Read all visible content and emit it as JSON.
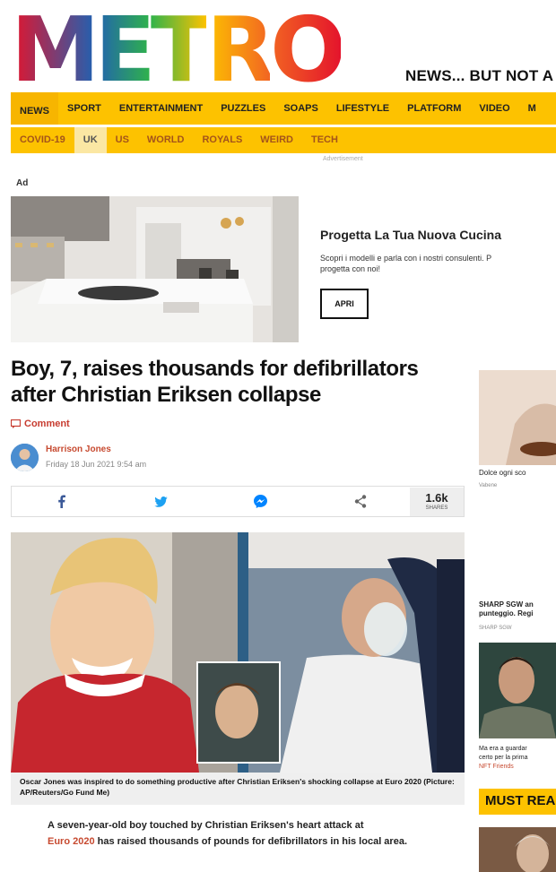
{
  "brand": {
    "logo_letters": [
      "M",
      "E",
      "T",
      "R",
      "O"
    ],
    "logo_colors": [
      "#e4142c",
      "#f26522",
      "#fdc200",
      "#2fb34a",
      "#2161b1",
      "#6b2fa0"
    ],
    "tagline": "NEWS... BUT NOT A"
  },
  "nav_primary": [
    {
      "label": "NEWS",
      "active": true
    },
    {
      "label": "SPORT"
    },
    {
      "label": "ENTERTAINMENT"
    },
    {
      "label": "PUZZLES"
    },
    {
      "label": "SOAPS"
    },
    {
      "label": "LIFESTYLE"
    },
    {
      "label": "PLATFORM"
    },
    {
      "label": "VIDEO"
    },
    {
      "label": "M"
    }
  ],
  "nav_secondary": [
    {
      "label": "COVID-19"
    },
    {
      "label": "UK",
      "active": true
    },
    {
      "label": "US"
    },
    {
      "label": "WORLD"
    },
    {
      "label": "ROYALS"
    },
    {
      "label": "WEIRD"
    },
    {
      "label": "TECH"
    }
  ],
  "ad": {
    "top_label": "Advertisement",
    "tag": "Ad",
    "title": "Progetta La Tua Nuova Cucina",
    "desc_line1": "Scopri i modelli e parla con i nostri consulenti. P",
    "desc_line2": "progetta con noi!",
    "button": "APRI"
  },
  "article": {
    "headline": "Boy, 7, raises thousands for defibrillators after Christian Eriksen collapse",
    "comment_label": "Comment",
    "author": "Harrison Jones",
    "date": "Friday 18 Jun 2021 9:54 am",
    "share_count": "1.6k",
    "share_label": "SHARES",
    "caption": "Oscar Jones was inspired to do something productive after Christian Eriksen's shocking collapse at Euro 2020 (Picture: AP/Reuters/Go Fund Me)",
    "lead_part1": "A seven-year-old boy touched by Christian Eriksen's heart attack at",
    "lead_link": "Euro 2020",
    "lead_part2": " has raised thousands of pounds for defibrillators in his local area."
  },
  "share_icons": [
    "facebook-icon",
    "twitter-icon",
    "messenger-icon",
    "share-icon"
  ],
  "sidebar": {
    "cap1": "Dolce ogni sco",
    "src1": "Vabene",
    "cap2_line1": "SHARP SGW an",
    "cap2_line2": "punteggio. Regi",
    "src2": "SHARP SGW",
    "cap3_line1": "Ma era a guardar",
    "cap3_line2": "certo per la prima",
    "cap3_line3": "NFT Friends",
    "must_read": "MUST REA"
  },
  "colors": {
    "nav_yellow": "#fdc200",
    "accent_red": "#c74a30"
  }
}
